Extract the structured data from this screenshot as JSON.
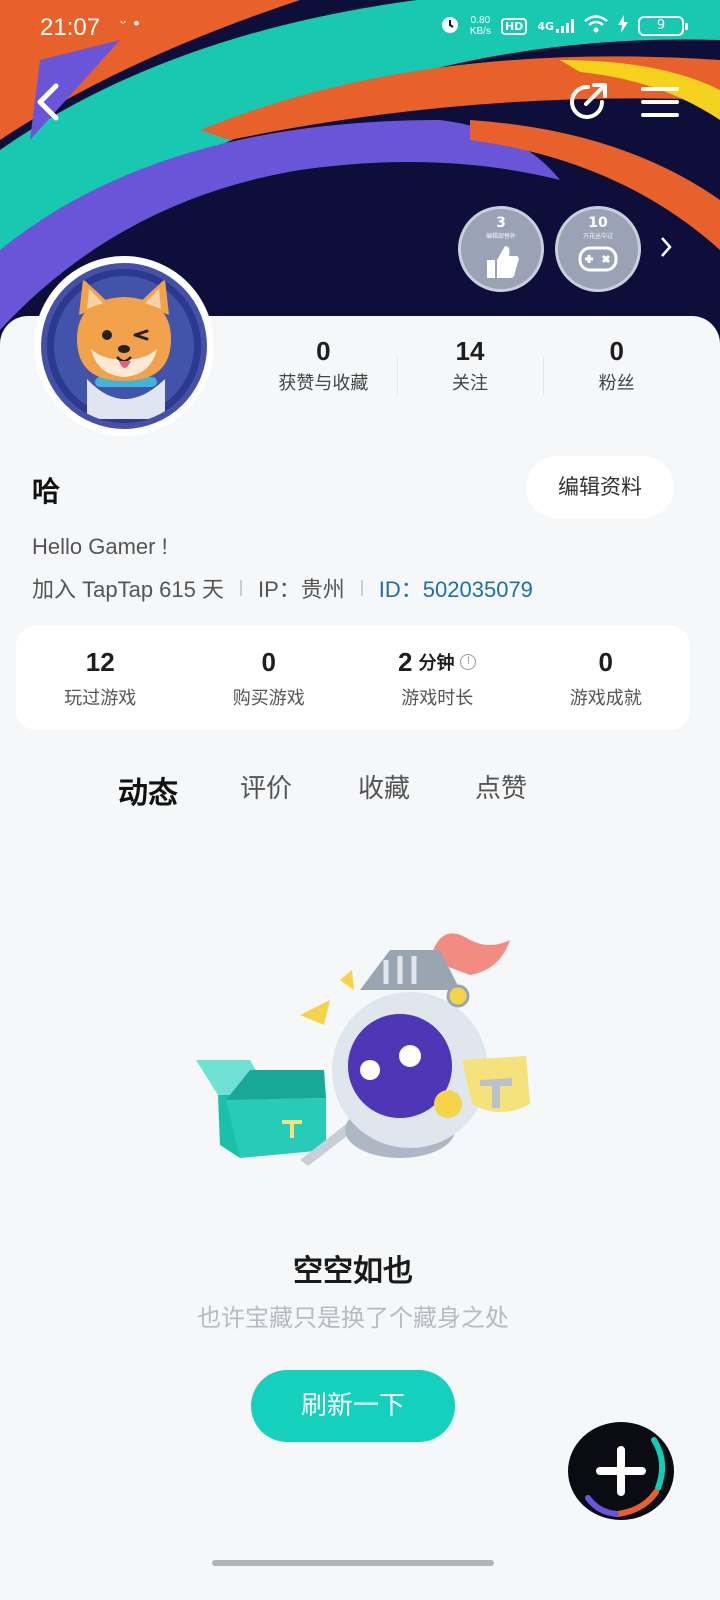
{
  "status_bar": {
    "time": "21:07",
    "notif_dots": "ᵕ •",
    "net_speed_value": "0.80",
    "net_speed_unit": "KB/s",
    "hd": "HD",
    "signal": "4G",
    "battery": "9"
  },
  "header": {
    "back_icon": "chevron-left-icon",
    "share_icon": "share-icon",
    "menu_icon": "menu-icon"
  },
  "medals": [
    {
      "num": "3",
      "caption": "编辑部替补",
      "icon": "thumbs-up-icon"
    },
    {
      "num": "10",
      "caption": "万花丛中过",
      "icon": "gamepad-icon"
    }
  ],
  "profile": {
    "stats": [
      {
        "value": "0",
        "label": "获赞与收藏"
      },
      {
        "value": "14",
        "label": "关注"
      },
      {
        "value": "0",
        "label": "粉丝"
      }
    ],
    "username": "哈",
    "edit_label": "编辑资料",
    "bio": "Hello Gamer !",
    "joined": "加入 TapTap 615 天",
    "ip": "IP：贵州",
    "id": "ID：502035079"
  },
  "game_stats": [
    {
      "value": "12",
      "unit": "",
      "label": "玩过游戏"
    },
    {
      "value": "0",
      "unit": "",
      "label": "购买游戏"
    },
    {
      "value": "2",
      "unit": "分钟",
      "label": "游戏时长",
      "info": "!"
    },
    {
      "value": "0",
      "unit": "",
      "label": "游戏成就"
    }
  ],
  "tabs": [
    {
      "label": "动态",
      "active": true
    },
    {
      "label": "评价",
      "active": false
    },
    {
      "label": "收藏",
      "active": false
    },
    {
      "label": "点赞",
      "active": false
    }
  ],
  "empty_state": {
    "title": "空空如也",
    "subtitle": "也许宝藏只是换了个藏身之处",
    "button": "刷新一下"
  },
  "fab_icon": "plus-icon",
  "colors": {
    "accent": "#15d0bd",
    "id_link": "#1e6fa6",
    "banner_bg": "#0d0e3a"
  }
}
